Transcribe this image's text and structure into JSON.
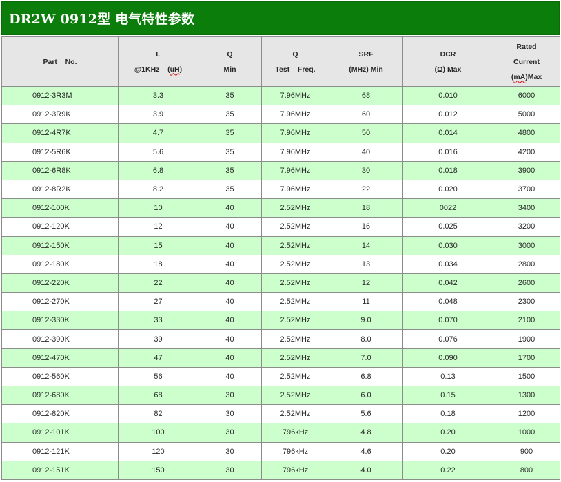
{
  "title": "DR2W 0912型 电气特性参数",
  "headers": {
    "part": [
      "Part    No."
    ],
    "l": [
      "L",
      "@1KHz    (",
      "uH",
      ")"
    ],
    "q_min": [
      "Q",
      "Min"
    ],
    "q_test": [
      "Q",
      "Test    Freq."
    ],
    "srf": [
      "SRF",
      "(MHz) Min"
    ],
    "dcr": [
      "DCR",
      "(Ω) Max"
    ],
    "rated": [
      "Rated",
      "Current",
      "mA",
      ")Max"
    ]
  },
  "rows": [
    {
      "part": "0912-3R3M",
      "l": "3.3",
      "q": "35",
      "freq": "7.96MHz",
      "srf": "68",
      "dcr": "0.010",
      "current": "6000"
    },
    {
      "part": "0912-3R9K",
      "l": "3.9",
      "q": "35",
      "freq": "7.96MHz",
      "srf": "60",
      "dcr": "0.012",
      "current": "5000"
    },
    {
      "part": "0912-4R7K",
      "l": "4.7",
      "q": "35",
      "freq": "7.96MHz",
      "srf": "50",
      "dcr": "0.014",
      "current": "4800"
    },
    {
      "part": "0912-5R6K",
      "l": "5.6",
      "q": "35",
      "freq": "7.96MHz",
      "srf": "40",
      "dcr": "0.016",
      "current": "4200"
    },
    {
      "part": "0912-6R8K",
      "l": "6.8",
      "q": "35",
      "freq": "7.96MHz",
      "srf": "30",
      "dcr": "0.018",
      "current": "3900"
    },
    {
      "part": "0912-8R2K",
      "l": "8.2",
      "q": "35",
      "freq": "7.96MHz",
      "srf": "22",
      "dcr": "0.020",
      "current": "3700"
    },
    {
      "part": "0912-100K",
      "l": "10",
      "q": "40",
      "freq": "2.52MHz",
      "srf": "18",
      "dcr": "0022",
      "current": "3400"
    },
    {
      "part": "0912-120K",
      "l": "12",
      "q": "40",
      "freq": "2.52MHz",
      "srf": "16",
      "dcr": "0.025",
      "current": "3200"
    },
    {
      "part": "0912-150K",
      "l": "15",
      "q": "40",
      "freq": "2.52MHz",
      "srf": "14",
      "dcr": "0.030",
      "current": "3000"
    },
    {
      "part": "0912-180K",
      "l": "18",
      "q": "40",
      "freq": "2.52MHz",
      "srf": "13",
      "dcr": "0.034",
      "current": "2800"
    },
    {
      "part": "0912-220K",
      "l": "22",
      "q": "40",
      "freq": "2.52MHz",
      "srf": "12",
      "dcr": "0.042",
      "current": "2600"
    },
    {
      "part": "0912-270K",
      "l": "27",
      "q": "40",
      "freq": "2.52MHz",
      "srf": "11",
      "dcr": "0.048",
      "current": "2300"
    },
    {
      "part": "0912-330K",
      "l": "33",
      "q": "40",
      "freq": "2.52MHz",
      "srf": "9.0",
      "dcr": "0.070",
      "current": "2100"
    },
    {
      "part": "0912-390K",
      "l": "39",
      "q": "40",
      "freq": "2.52MHz",
      "srf": "8.0",
      "dcr": "0.076",
      "current": "1900"
    },
    {
      "part": "0912-470K",
      "l": "47",
      "q": "40",
      "freq": "2.52MHz",
      "srf": "7.0",
      "dcr": "0.090",
      "current": "1700"
    },
    {
      "part": "0912-560K",
      "l": "56",
      "q": "40",
      "freq": "2.52MHz",
      "srf": "6.8",
      "dcr": "0.13",
      "current": "1500"
    },
    {
      "part": "0912-680K",
      "l": "68",
      "q": "30",
      "freq": "2.52MHz",
      "srf": "6.0",
      "dcr": "0.15",
      "current": "1300"
    },
    {
      "part": "0912-820K",
      "l": "82",
      "q": "30",
      "freq": "2.52MHz",
      "srf": "5.6",
      "dcr": "0.18",
      "current": "1200"
    },
    {
      "part": "0912-101K",
      "l": "100",
      "q": "30",
      "freq": "796kHz",
      "srf": "4.8",
      "dcr": "0.20",
      "current": "1000"
    },
    {
      "part": "0912-121K",
      "l": "120",
      "q": "30",
      "freq": "796kHz",
      "srf": "4.6",
      "dcr": "0.20",
      "current": "900"
    },
    {
      "part": "0912-151K",
      "l": "150",
      "q": "30",
      "freq": "796kHz",
      "srf": "4.0",
      "dcr": "0.22",
      "current": "800"
    }
  ],
  "colors": {
    "title_bg": "#0b7d0b",
    "header_bg": "#e6e6e6",
    "alt_row_bg": "#ccffcc",
    "border": "#8c8c8c"
  }
}
